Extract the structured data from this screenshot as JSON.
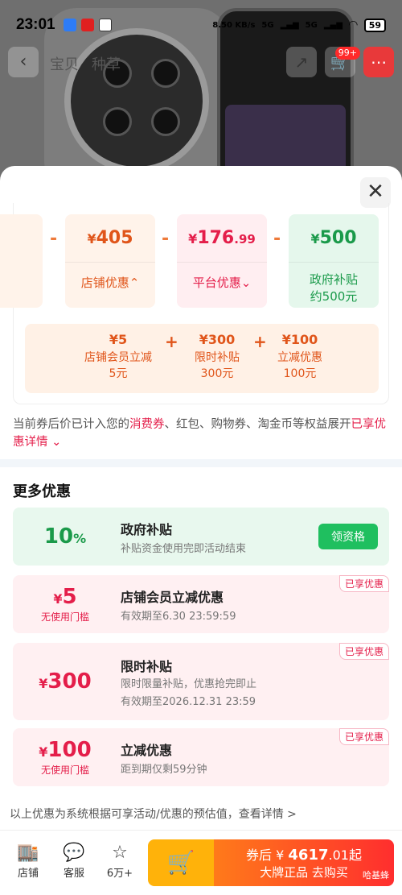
{
  "status_bar": {
    "time": "23:01",
    "network_speed": "8.50 KB/s",
    "signal1": "5G",
    "signal2": "5G",
    "battery": "59"
  },
  "top_nav": {
    "tabs": [
      "宝贝",
      "种草"
    ],
    "cart_badge": "99+"
  },
  "calc": {
    "cards": [
      {
        "currency": "¥",
        "amount": "405",
        "decimal": "",
        "label": "店铺优惠⌃",
        "label2": "",
        "bg": "#fff3ea",
        "color": "#e0551a"
      },
      {
        "currency": "¥",
        "amount": "176",
        "decimal": ".99",
        "label": "平台优惠⌄",
        "label2": "",
        "bg": "#ffeef1",
        "color": "#e41e4a"
      },
      {
        "currency": "¥",
        "amount": "500",
        "decimal": "",
        "label": "政府补贴",
        "label2": "约500元",
        "bg": "#e5f7ec",
        "color": "#1a9a4a"
      }
    ],
    "sub_items": [
      {
        "amount": "¥5",
        "line1": "店铺会员立减",
        "line2": "5元"
      },
      {
        "amount": "¥300",
        "line1": "限时补贴",
        "line2": "300元"
      },
      {
        "amount": "¥100",
        "line1": "立减优惠",
        "line2": "100元"
      }
    ]
  },
  "note": {
    "part1": "当前券后价已计入您的",
    "hl1": "消费券",
    "part2": "、红包、购物券、淘金币等权益展开",
    "hl2": "已享优惠详情 ⌄"
  },
  "section_title": "更多优惠",
  "offers": [
    {
      "value": "10",
      "unit": "%",
      "sub": "",
      "title": "政府补贴",
      "desc1": "补贴资金使用完即活动结束",
      "desc2": "",
      "button": "领资格",
      "tag": ""
    },
    {
      "value": "5",
      "unit": "¥",
      "sub": "无使用门槛",
      "title": "店铺会员立减优惠",
      "desc1": "有效期至6.30 23:59:59",
      "desc2": "",
      "button": "",
      "tag": "已享优惠"
    },
    {
      "value": "300",
      "unit": "¥",
      "sub": "",
      "title": "限时补贴",
      "desc1": "限时限量补贴，优惠抢完即止",
      "desc2": "有效期至2026.12.31 23:59",
      "button": "",
      "tag": "已享优惠"
    },
    {
      "value": "100",
      "unit": "¥",
      "sub": "无使用门槛",
      "title": "立减优惠",
      "desc1": "距到期仅剩59分钟",
      "desc2": "",
      "button": "",
      "tag": "已享优惠"
    }
  ],
  "footer_note": "以上优惠为系统根据可享活动/优惠的预估值，查看详情 >",
  "bottom_bar": {
    "shop": "店铺",
    "service": "客服",
    "favorites": "6万+",
    "buy_line1_prefix": "券后 ¥ ",
    "buy_price": "4617",
    "buy_price_dec": ".01",
    "buy_line1_suffix": "起",
    "buy_line2": "大牌正品  去购买",
    "watermark": "哈基蜂"
  },
  "colors": {
    "accent_red": "#e41e4a",
    "accent_orange": "#e0551a",
    "accent_green": "#1fbf5f",
    "cart_yellow": "#ffb20a"
  }
}
